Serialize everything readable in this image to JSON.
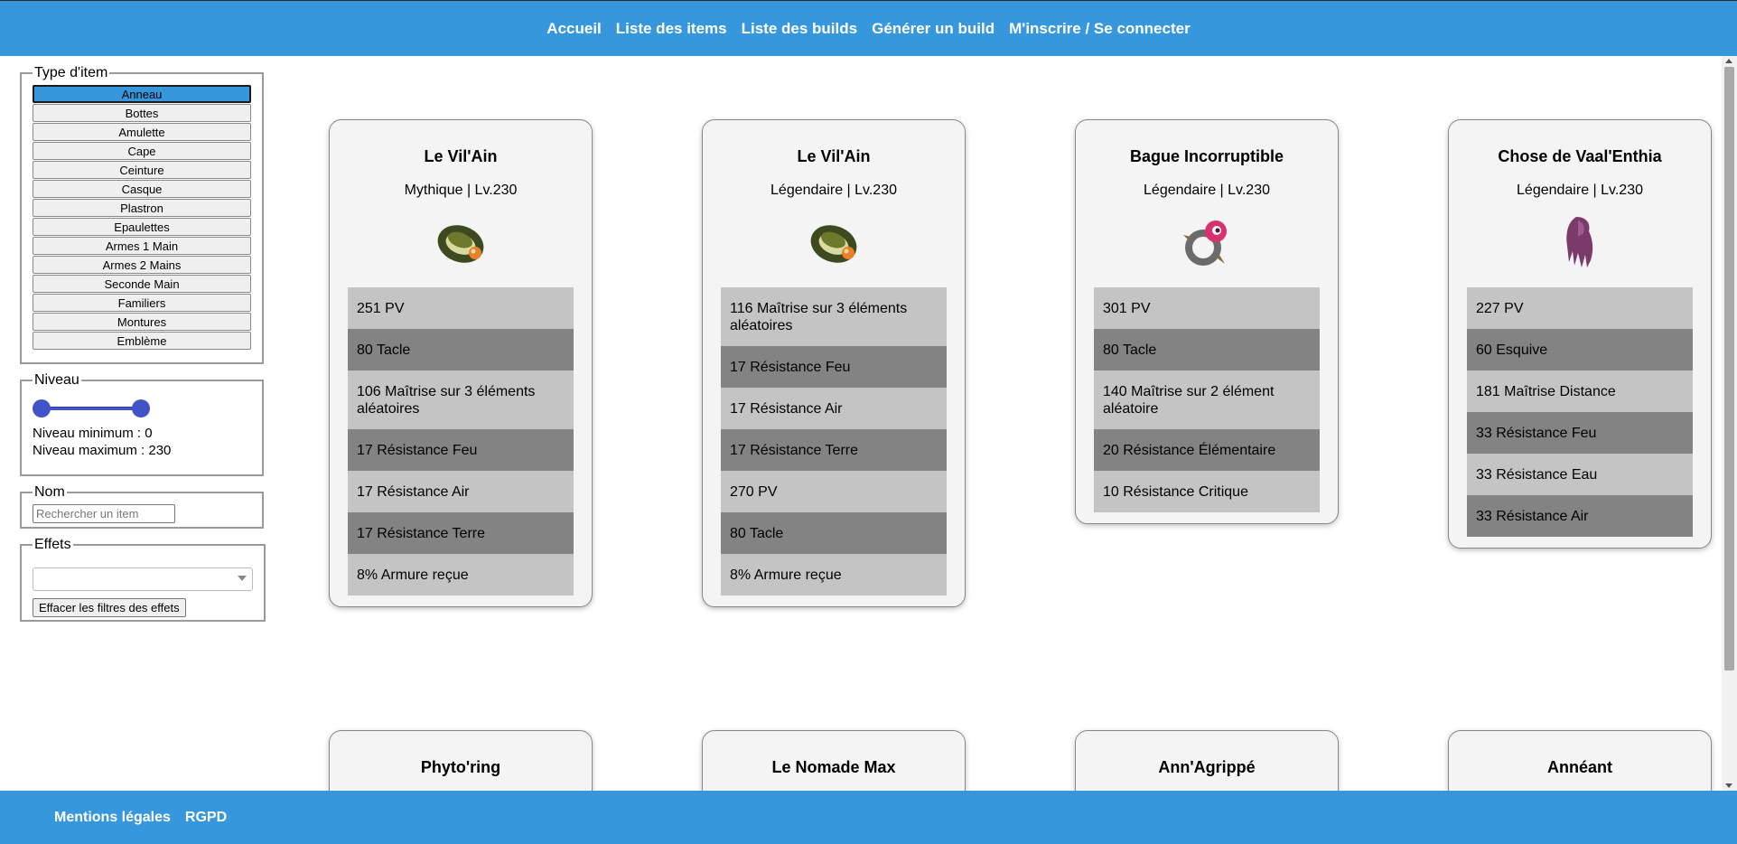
{
  "nav": {
    "items": [
      "Accueil",
      "Liste des items",
      "Liste des builds",
      "Générer un build",
      "M'inscrire / Se connecter"
    ]
  },
  "footer": {
    "links": [
      "Mentions légales",
      "RGPD"
    ]
  },
  "filters": {
    "type_legend": "Type d'item",
    "types": [
      "Anneau",
      "Bottes",
      "Amulette",
      "Cape",
      "Ceinture",
      "Casque",
      "Plastron",
      "Epaulettes",
      "Armes 1 Main",
      "Armes 2 Mains",
      "Seconde Main",
      "Familiers",
      "Montures",
      "Emblème"
    ],
    "selected_type": "Anneau",
    "level_legend": "Niveau",
    "level_min_text": "Niveau minimum : 0",
    "level_max_text": "Niveau maximum : 230",
    "level_min": 0,
    "level_max": 230,
    "name_legend": "Nom",
    "name_placeholder": "Rechercher un item",
    "effects_legend": "Effets",
    "effects_selected": "",
    "clear_button": "Effacer les filtres des effets"
  },
  "items": [
    {
      "name": "Le Vil'Ain",
      "rarity_level": "Mythique | Lv.230",
      "icon": "ring-green-orange-icon",
      "stats": [
        "251 PV",
        "80 Tacle",
        "106 Maîtrise sur 3 éléments aléatoires",
        "17 Résistance Feu",
        "17 Résistance Air",
        "17 Résistance Terre",
        "8% Armure reçue"
      ]
    },
    {
      "name": "Le Vil'Ain",
      "rarity_level": "Légendaire | Lv.230",
      "icon": "ring-green-orange-icon",
      "stats": [
        "116 Maîtrise sur 3 éléments aléatoires",
        "17 Résistance Feu",
        "17 Résistance Air",
        "17 Résistance Terre",
        "270 PV",
        "80 Tacle",
        "8% Armure reçue"
      ]
    },
    {
      "name": "Bague Incorruptible",
      "rarity_level": "Légendaire | Lv.230",
      "icon": "ring-pink-eye-icon",
      "stats": [
        "301 PV",
        "80 Tacle",
        "140 Maîtrise sur 2 élément aléatoire",
        "20 Résistance Élémentaire",
        "10 Résistance Critique"
      ]
    },
    {
      "name": "Chose de Vaal'Enthia",
      "rarity_level": "Légendaire | Lv.230",
      "icon": "purple-claw-icon",
      "stats": [
        "227 PV",
        "60 Esquive",
        "181 Maîtrise Distance",
        "33 Résistance Feu",
        "33 Résistance Eau",
        "33 Résistance Air"
      ]
    },
    {
      "name": "Phyto'ring"
    },
    {
      "name": "Le Nomade Max"
    },
    {
      "name": "Ann'Agrippé"
    },
    {
      "name": "Annéant"
    }
  ],
  "colors": {
    "brand": "#3797dd",
    "card_bg": "#f4f4f4",
    "stat_light": "#c4c4c4",
    "stat_dark": "#838383",
    "slider": "#4253c5"
  }
}
